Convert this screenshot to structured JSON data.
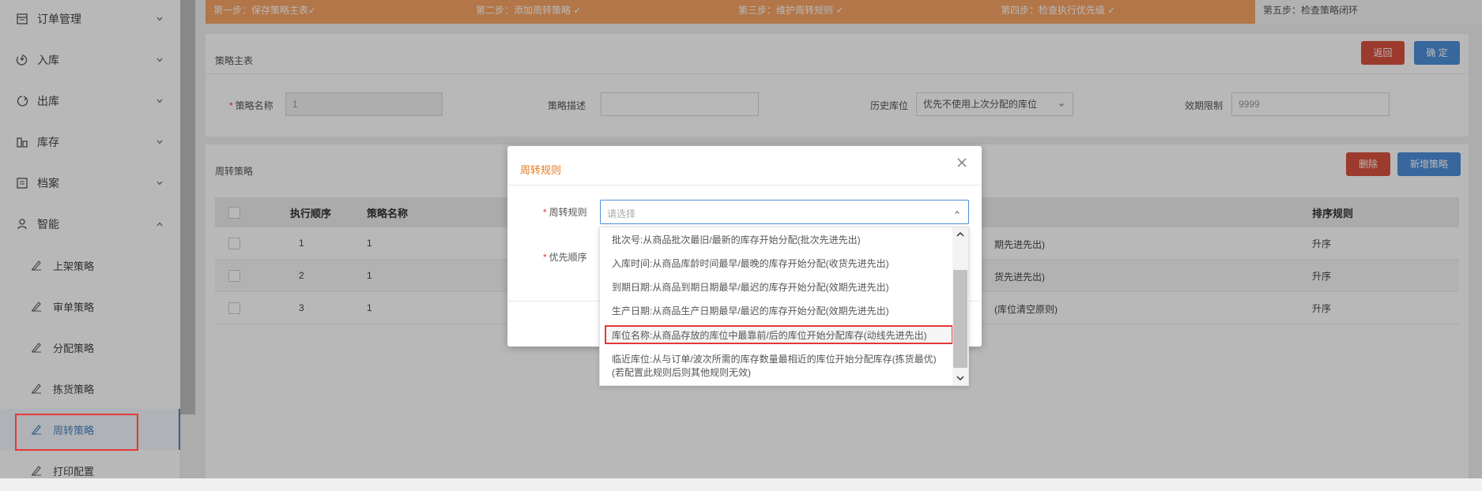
{
  "sidebar": {
    "items": [
      {
        "label": "订单管理",
        "icon": "order-icon"
      },
      {
        "label": "入库",
        "icon": "inbound-icon"
      },
      {
        "label": "出库",
        "icon": "outbound-icon"
      },
      {
        "label": "库存",
        "icon": "inventory-icon"
      },
      {
        "label": "档案",
        "icon": "archive-icon"
      },
      {
        "label": "智能",
        "icon": "smart-icon"
      }
    ],
    "sub_items": [
      {
        "label": "上架策略",
        "icon": "strategy-icon"
      },
      {
        "label": "审单策略",
        "icon": "strategy-icon"
      },
      {
        "label": "分配策略",
        "icon": "strategy-icon"
      },
      {
        "label": "拣货策略",
        "icon": "strategy-icon"
      },
      {
        "label": "周转策略",
        "icon": "strategy-icon",
        "active": true
      },
      {
        "label": "打印配置",
        "icon": "strategy-icon"
      }
    ]
  },
  "steps": [
    "第一步：保存策略主表✓",
    "第二步：添加周转策略 ✓",
    "第三步：维护周转规则 ✓",
    "第四步：检查执行优先级 ✓",
    "第五步：检查策略闭环"
  ],
  "master": {
    "title": "策略主表",
    "back_label": "返回",
    "confirm_label": "确 定",
    "name_label": "策略名称",
    "name_value": "1",
    "desc_label": "策略描述",
    "desc_value": "",
    "history_label": "历史库位",
    "history_value": "优先不使用上次分配的库位",
    "expiry_label": "效期限制",
    "expiry_value": "9999"
  },
  "turnover": {
    "title": "周转策略",
    "delete_label": "删除",
    "add_label": "新增策略",
    "headers": {
      "order": "执行顺序",
      "name": "策略名称",
      "sort": "排序规则"
    },
    "rows": [
      {
        "order": "1",
        "name": "1",
        "rule_tail": "期先进先出)",
        "sort": "升序"
      },
      {
        "order": "2",
        "name": "1",
        "rule_tail": "货先进先出)",
        "sort": "升序"
      },
      {
        "order": "3",
        "name": "1",
        "rule_tail": "(库位清空原则)",
        "sort": "升序"
      }
    ]
  },
  "dialog": {
    "title": "周转规则",
    "rule_label": "周转规则",
    "rule_placeholder": "请选择",
    "priority_label": "优先顺序"
  },
  "dropdown": {
    "options": [
      "批次号:从商品批次最旧/最新的库存开始分配(批次先进先出)",
      "入库时间:从商品库龄时间最早/最晚的库存开始分配(收货先进先出)",
      "到期日期:从商品到期日期最早/最迟的库存开始分配(效期先进先出)",
      "生产日期:从商品生产日期最早/最迟的库存开始分配(效期先进先出)",
      "库位名称:从商品存放的库位中最靠前/后的库位开始分配库存(动线先进先出)",
      "临近库位:从与订单/波次所需的库存数量最相近的库位开始分配库存(拣货最优)",
      "(若配置此规则后则其他规则无效)"
    ]
  }
}
